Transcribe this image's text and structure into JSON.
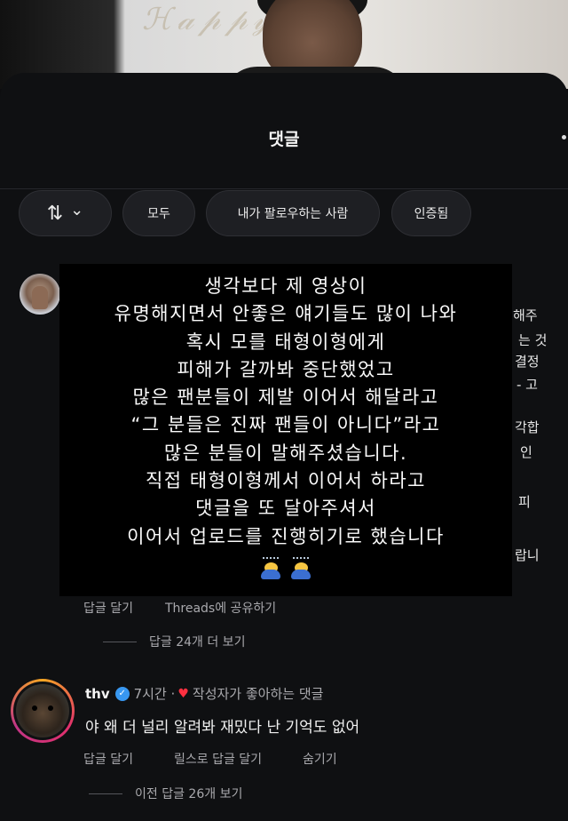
{
  "sheet": {
    "title": "댓글"
  },
  "filters": {
    "sort_icon": "⇅",
    "sort_caret": "⌄",
    "all": "모두",
    "following": "내가 팔로우하는 사람",
    "verified": "인증됨"
  },
  "comment1": {
    "overlay_lines": [
      "생각보다 제 영상이",
      "유명해지면서 안좋은 얘기들도 많이 나와",
      "혹시 모를 태형이형에게",
      "피해가 갈까봐 중단했었고",
      "많은 팬분들이 제발 이어서 해달라고",
      "“그 분들은 진짜 팬들이 아니다”라고",
      "많은 분들이 말해주셨습니다.",
      "직접 태형이형께서 이어서 하라고",
      "댓글을 또 달아주셔서",
      "이어서 업로드를 진행히기로 했습니다"
    ],
    "side_fragments": [
      "해주",
      "는 것",
      "결정",
      "- 고",
      "각합",
      "인",
      "피",
      "랍니"
    ],
    "actions": {
      "reply": "답글 달기",
      "share": "Threads에 공유하기"
    },
    "more_replies": "답글 24개 더 보기"
  },
  "comment2": {
    "username": "thv",
    "verified_icon": "✓",
    "time": "7시간 ·",
    "heart_icon": "♥",
    "liked_by_author": "작성자가 좋아하는 댓글",
    "text": "야 왜 더 널리 알려봐 재밌다 난 기억도 없어",
    "actions": {
      "reply": "답글 달기",
      "reels_reply": "릴스로 답글 달기",
      "hide": "숨기기"
    },
    "prev_replies": "이전 답글 26개 보기"
  }
}
